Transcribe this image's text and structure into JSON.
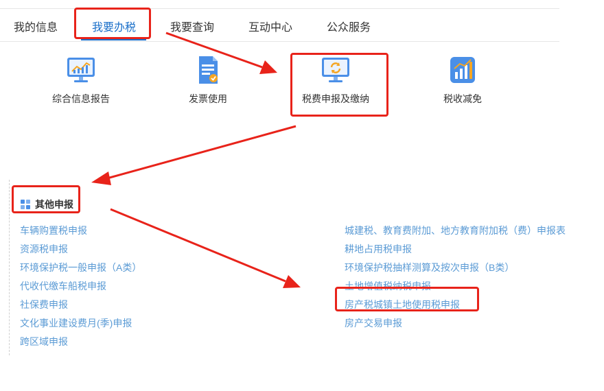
{
  "nav": {
    "tabs": [
      {
        "label": "我的信息"
      },
      {
        "label": "我要办税"
      },
      {
        "label": "我要查询"
      },
      {
        "label": "互动中心"
      },
      {
        "label": "公众服务"
      }
    ]
  },
  "tiles": [
    {
      "label": "综合信息报告",
      "icon": "chart-monitor-icon"
    },
    {
      "label": "发票使用",
      "icon": "invoice-icon"
    },
    {
      "label": "税费申报及缴纳",
      "icon": "refresh-monitor-icon"
    },
    {
      "label": "税收减免",
      "icon": "bar-chart-icon"
    }
  ],
  "section": {
    "title": "其他申报",
    "left_links": [
      "车辆购置税申报",
      "资源税申报",
      "环境保护税一般申报（A类）",
      "代收代缴车船税申报",
      "社保费申报",
      "文化事业建设费月(季)申报",
      "跨区域申报"
    ],
    "right_links": [
      "城建税、教育费附加、地方教育附加税（费）申报表",
      "耕地占用税申报",
      "环境保护税抽样测算及按次申报（B类）",
      "土地增值税纳税申报",
      "房产税城镇土地使用税申报",
      "房产交易申报"
    ]
  },
  "colors": {
    "accent": "#1a6fc9",
    "link": "#5b9bd5",
    "highlight": "#e8231a"
  }
}
